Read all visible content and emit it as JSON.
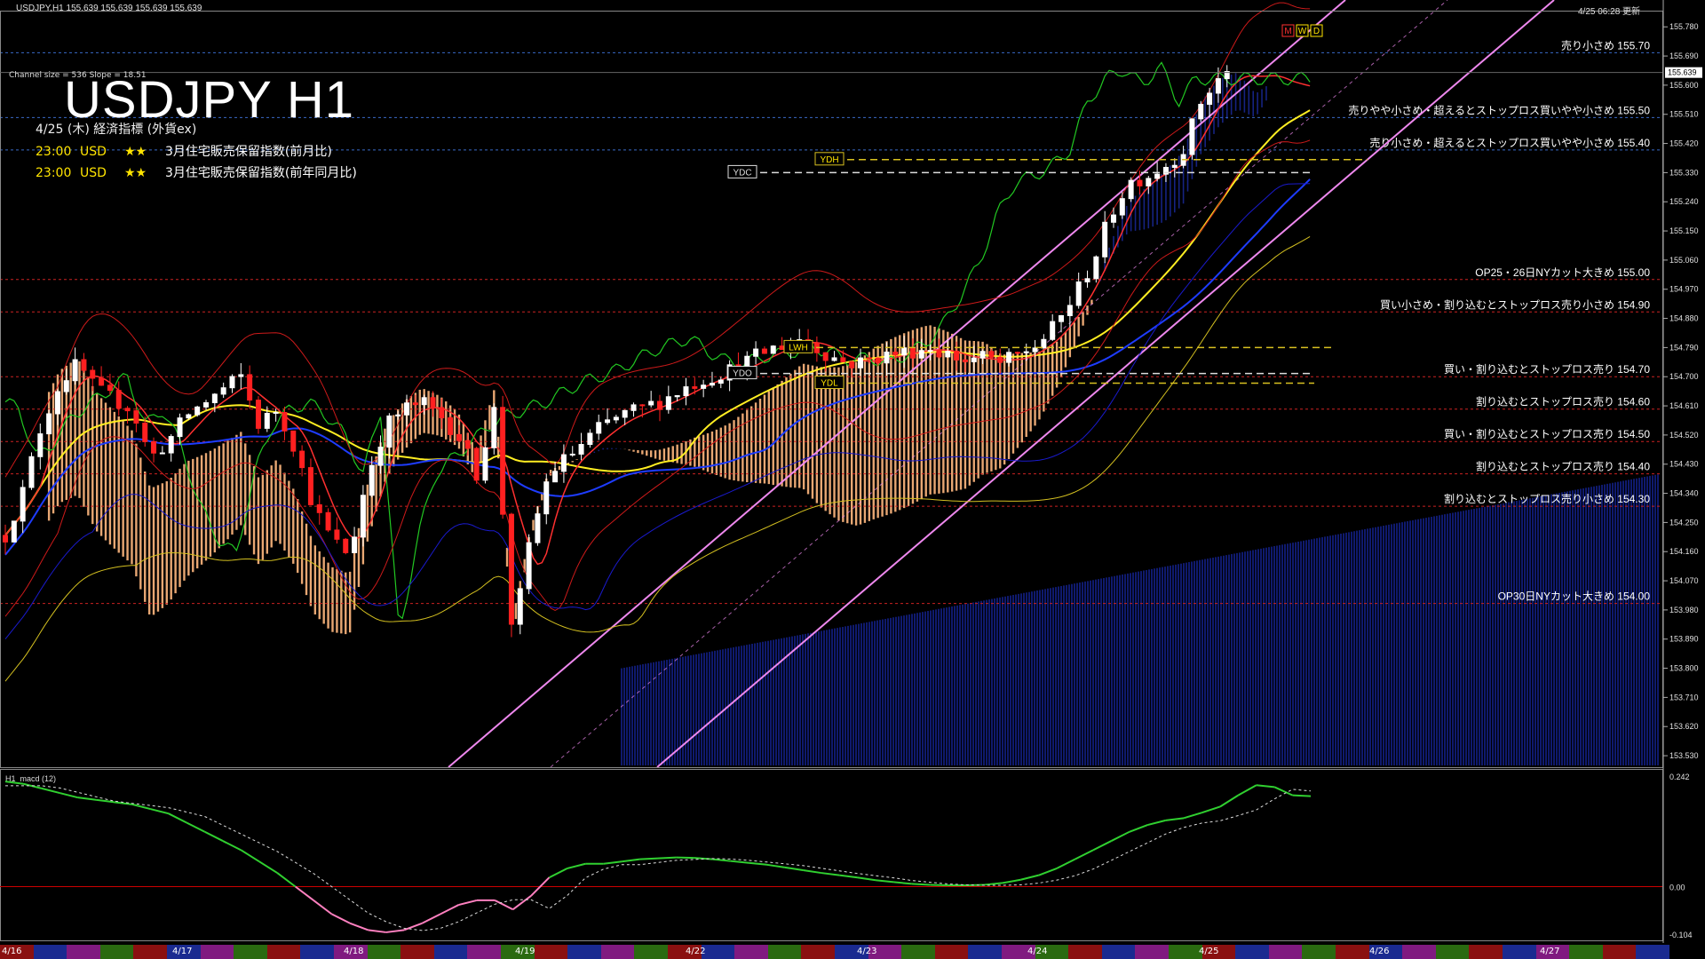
{
  "header": {
    "symbol_info": "USDJPY,H1  155.639 155.639 155.639 155.639",
    "datetime": "4/25 06:28 更新"
  },
  "title": "USDJPY H1",
  "channel_info": "Channel size = 536  Slope = 18.51",
  "eco": {
    "title": "4/25 (木) 経済指標 (外貨ex)",
    "rows": [
      {
        "time": "23:00",
        "currency": "USD",
        "stars": "★★",
        "name": "3月住宅販売保留指数(前月比)"
      },
      {
        "time": "23:00",
        "currency": "USD",
        "stars": "★★",
        "name": "3月住宅販売保留指数(前年同月比)"
      }
    ]
  },
  "colors": {
    "background": "#000000",
    "bull": "#ffffff",
    "bear": "#ff2020",
    "ma_yellow": "#ffee22",
    "ma_blue": "#1e3cff",
    "chikou": "#22c822",
    "kumo_bull": "#f5b07a",
    "kumo_bear": "#1a2a99",
    "channel": "#ee88ee",
    "level_line": "#cc2222",
    "level_line_blue": "#3a6ac8",
    "macd_line": "#30d030",
    "macd_line_neg": "#ff80c0"
  },
  "chart_data": {
    "type": "candlestick",
    "symbol": "USDJPY",
    "timeframe": "H1",
    "ylim": [
      153.5,
      155.83
    ],
    "yticks": [
      155.78,
      155.69,
      155.6,
      155.51,
      155.42,
      155.33,
      155.24,
      155.15,
      155.06,
      154.97,
      154.88,
      154.79,
      154.7,
      154.61,
      154.52,
      154.43,
      154.34,
      154.25,
      154.16,
      154.07,
      153.98,
      153.89,
      153.8,
      153.71,
      153.62,
      153.53
    ],
    "ytick_labels": [
      "155.780",
      "155.690",
      "155.600",
      "155.510",
      "155.420",
      "155.330",
      "155.240",
      "155.150",
      "155.060",
      "154.970",
      "154.880",
      "154.790",
      "154.700",
      "154.610",
      "154.520",
      "154.430",
      "154.340",
      "154.250",
      "154.160",
      "154.070",
      "153.980",
      "153.890",
      "153.800",
      "153.710",
      "153.620",
      "153.530"
    ],
    "current_price": "155.639",
    "dates": [
      "4/16",
      "4/17",
      "4/18",
      "4/19",
      "4/22",
      "4/23",
      "4/24",
      "4/25",
      "4/26",
      "4/27"
    ],
    "close_path": [
      154.21,
      154.35,
      154.55,
      154.68,
      154.74,
      154.66,
      154.63,
      154.6,
      154.45,
      154.5,
      154.58,
      154.62,
      154.66,
      154.7,
      154.55,
      154.6,
      154.48,
      154.3,
      154.2,
      154.15,
      154.4,
      154.55,
      154.6,
      154.62,
      154.58,
      154.52,
      154.4,
      154.6,
      153.9,
      154.2,
      154.4,
      154.45,
      154.5,
      154.55,
      154.58,
      154.6,
      154.62,
      154.65,
      154.68,
      154.7,
      154.72,
      154.75,
      154.78,
      154.8,
      154.82,
      154.78,
      154.75,
      154.74,
      154.76,
      154.77,
      154.78,
      154.79,
      154.77,
      154.75,
      154.76,
      154.74,
      154.77,
      154.8,
      154.86,
      154.95,
      155.05,
      155.2,
      155.3,
      155.32,
      155.35,
      155.4,
      155.55,
      155.62,
      155.65,
      155.6,
      155.66,
      155.55,
      155.62
    ],
    "levels": [
      {
        "price": 155.7,
        "label": "売り小さめ 155.70",
        "style": "blue"
      },
      {
        "price": 155.5,
        "label": "売りやや小さめ・超えるとストップロス買いやや小さめ 155.50",
        "style": "blue"
      },
      {
        "price": 155.4,
        "label": "売り小さめ・超えるとストップロス買いやや小さめ 155.40",
        "style": "blue"
      },
      {
        "price": 155.0,
        "label": "OP25・26日NYカット大きめ 155.00",
        "style": "red"
      },
      {
        "price": 154.9,
        "label": "買い小さめ・割り込むとストップロス売り小さめ 154.90",
        "style": "red"
      },
      {
        "price": 154.7,
        "label": "買い・割り込むとストップロス売り 154.70",
        "style": "red"
      },
      {
        "price": 154.6,
        "label": "割り込むとストップロス売り 154.60",
        "style": "red"
      },
      {
        "price": 154.5,
        "label": "買い・割り込むとストップロス売り 154.50",
        "style": "red"
      },
      {
        "price": 154.4,
        "label": "割り込むとストップロス売り 154.40",
        "style": "red"
      },
      {
        "price": 154.3,
        "label": "割り込むとストップロス売り小さめ 154.30",
        "style": "red"
      },
      {
        "price": 154.0,
        "label": "OP30日NYカット大きめ 154.00",
        "style": "red"
      }
    ],
    "markers": [
      {
        "label": "YDH",
        "price": 155.37
      },
      {
        "label": "YDC",
        "price": 155.33
      },
      {
        "label": "LWH",
        "price": 154.79
      },
      {
        "label": "YDO",
        "price": 154.71
      },
      {
        "label": "YDL",
        "price": 154.68
      },
      {
        "label": "M"
      },
      {
        "label": "W"
      },
      {
        "label": "D"
      }
    ],
    "macd": {
      "title": "H1_macd (12)",
      "ytick_labels": [
        "0.242",
        "0.00",
        "-0.104"
      ],
      "values": [
        0.23,
        0.225,
        0.215,
        0.205,
        0.195,
        0.19,
        0.185,
        0.18,
        0.17,
        0.16,
        0.14,
        0.12,
        0.1,
        0.08,
        0.055,
        0.03,
        0.0,
        -0.03,
        -0.06,
        -0.08,
        -0.095,
        -0.1,
        -0.095,
        -0.08,
        -0.06,
        -0.04,
        -0.03,
        -0.03,
        -0.05,
        -0.02,
        0.02,
        0.04,
        0.05,
        0.05,
        0.055,
        0.06,
        0.062,
        0.064,
        0.063,
        0.06,
        0.056,
        0.052,
        0.048,
        0.042,
        0.036,
        0.03,
        0.025,
        0.02,
        0.014,
        0.01,
        0.006,
        0.004,
        0.003,
        0.003,
        0.004,
        0.008,
        0.015,
        0.025,
        0.04,
        0.06,
        0.08,
        0.1,
        0.12,
        0.135,
        0.145,
        0.15,
        0.162,
        0.175,
        0.2,
        0.222,
        0.218,
        0.2,
        0.198
      ]
    }
  }
}
